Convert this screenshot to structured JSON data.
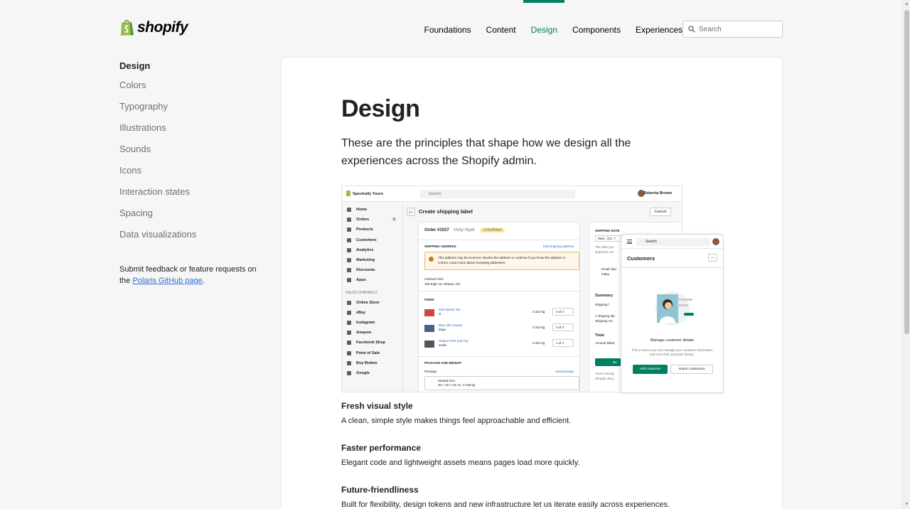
{
  "header": {
    "logo_text": "shopify",
    "nav": [
      "Foundations",
      "Content",
      "Design",
      "Components",
      "Experiences"
    ],
    "active_nav": "Design",
    "search_placeholder": "Search"
  },
  "sidebar": {
    "heading": "Design",
    "items": [
      "Colors",
      "Typography",
      "Illustrations",
      "Sounds",
      "Icons",
      "Interaction states",
      "Spacing",
      "Data visualizations"
    ],
    "feedback_prefix": "Submit feedback or feature requests on the",
    "feedback_link": "Polaris GitHub page",
    "feedback_suffix": "."
  },
  "main": {
    "title": "Design",
    "lead": "These are the principles that shape how we design all the experiences across the Shopify admin.",
    "principles": [
      {
        "title": "Fresh visual style",
        "desc": "A clean, simple style makes things feel approachable and efficient."
      },
      {
        "title": "Faster performance",
        "desc": "Elegant code and lightweight assets means pages load more quickly."
      },
      {
        "title": "Future-friendliness",
        "desc": "Built for flexibility, design tokens and new infrastructure let us iterate easily across experiences."
      }
    ]
  },
  "mock": {
    "store": "Spectrally Yours",
    "search": "Search",
    "user": "Roberta Brown",
    "nav": [
      "Home",
      "Orders",
      "Products",
      "Customers",
      "Analytics",
      "Marketing",
      "Discounts",
      "Apps"
    ],
    "orders_badge": "6",
    "sales_channels_label": "SALES CHANNELS",
    "channels": [
      "Online Store",
      "eBay",
      "Instagram",
      "Amazon",
      "Facebook Shop",
      "Point of Sale",
      "Buy Button",
      "Google"
    ],
    "heading": "Create shipping label",
    "cancel": "Cancel",
    "order_no": "Order #1037",
    "customer": "Vicky Hyatt",
    "status": "Unfulfilled",
    "shipping_address_label": "SHIPPING ADDRESS",
    "edit_address": "Edit shipping address",
    "warning": "This address may be incorrect. Review the address or continue if you know the address is correct. Learn more about reviewing addresses.",
    "address_name": "Garland Ortiz",
    "address_line": "150 Elgin St, Ottawa, ON",
    "items_label": "ITEMS",
    "items": [
      {
        "name": "Red Sports Tee",
        "variant": "xl",
        "weight": "0.322 kg",
        "qty": "3  of 3"
      },
      {
        "name": "Blue Silk Tuxedo",
        "variant": "large",
        "weight": "0.334 kg",
        "qty": "3  of 3"
      },
      {
        "name": "Striped Skirt and Top",
        "variant": "small",
        "weight": "0.401 kg",
        "qty": "1  of 1"
      }
    ],
    "package_label": "PACKAGE AND WEIGHT",
    "package_sub": "Package",
    "add_package": "Add package",
    "package_name": "Sample box",
    "package_dims": "30 × 20 × 15 cm, 0.168 kg",
    "shipping_date_label": "SHIPPING DATE",
    "shipping_date": "Wed , Oct. 7",
    "date_note": "The date you shipment out",
    "email_note": "Email ship today.",
    "summary_label": "Summary",
    "summary_item": "Shipping l",
    "summary_lines": "1 shipping lab Shipping cre",
    "total_label": "Total",
    "amount_billed": "Amount billed",
    "buy_button": "Bu",
    "saving_note": "You're saving Shopify disco"
  },
  "phone": {
    "search": "Search",
    "title": "Customers",
    "more": "...",
    "manage_title": "Manage customer details",
    "manage_desc": "This is where you can manage your customer information and view their purchase history.",
    "add_button": "Add customer",
    "import_button": "Import customers"
  },
  "colors": {
    "brand_green": "#008060",
    "link_blue": "#2c6ecb",
    "logo_green": "#95bf47"
  }
}
